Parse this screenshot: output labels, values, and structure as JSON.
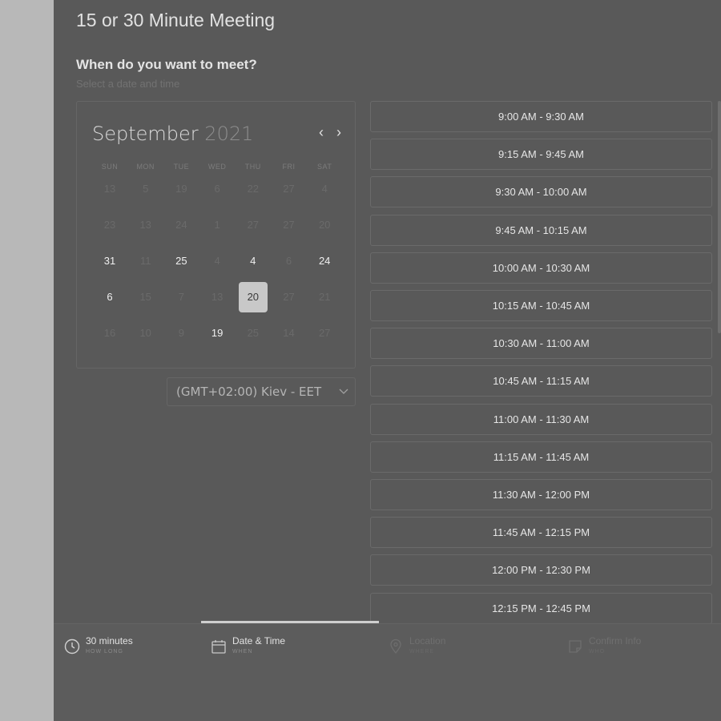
{
  "header": {
    "title": "15 or 30 Minute Meeting",
    "when_heading": "When do you want to meet?",
    "when_sub": "Select a date and time"
  },
  "calendar": {
    "month": "September",
    "year": "2021",
    "weekdays": [
      "SUN",
      "MON",
      "TUE",
      "WED",
      "THU",
      "FRI",
      "SAT"
    ],
    "weeks": [
      [
        {
          "d": "13",
          "a": false
        },
        {
          "d": "5",
          "a": false
        },
        {
          "d": "19",
          "a": false
        },
        {
          "d": "6",
          "a": false
        },
        {
          "d": "22",
          "a": false
        },
        {
          "d": "27",
          "a": false
        },
        {
          "d": "4",
          "a": false
        }
      ],
      [
        {
          "d": "23",
          "a": false
        },
        {
          "d": "13",
          "a": false
        },
        {
          "d": "24",
          "a": false
        },
        {
          "d": "1",
          "a": false
        },
        {
          "d": "27",
          "a": false
        },
        {
          "d": "27",
          "a": false
        },
        {
          "d": "20",
          "a": false
        }
      ],
      [
        {
          "d": "31",
          "a": true
        },
        {
          "d": "11",
          "a": false
        },
        {
          "d": "25",
          "a": true
        },
        {
          "d": "4",
          "a": false
        },
        {
          "d": "4",
          "a": true
        },
        {
          "d": "6",
          "a": false
        },
        {
          "d": "24",
          "a": true
        }
      ],
      [
        {
          "d": "6",
          "a": true
        },
        {
          "d": "15",
          "a": false
        },
        {
          "d": "7",
          "a": false
        },
        {
          "d": "13",
          "a": false
        },
        {
          "d": "20",
          "a": true,
          "selected": true
        },
        {
          "d": "27",
          "a": false
        },
        {
          "d": "21",
          "a": false
        }
      ],
      [
        {
          "d": "16",
          "a": false
        },
        {
          "d": "10",
          "a": false
        },
        {
          "d": "9",
          "a": false
        },
        {
          "d": "19",
          "a": true
        },
        {
          "d": "25",
          "a": false
        },
        {
          "d": "14",
          "a": false
        },
        {
          "d": "27",
          "a": false
        }
      ]
    ],
    "prev_icon": "chevron-left-icon",
    "next_icon": "chevron-right-icon"
  },
  "timezone": {
    "value": "(GMT+02:00) Kiev - EET",
    "icon": "chevron-down-icon"
  },
  "slots": [
    "9:00 AM - 9:30 AM",
    "9:15 AM - 9:45 AM",
    "9:30 AM - 10:00 AM",
    "9:45 AM - 10:15 AM",
    "10:00 AM - 10:30 AM",
    "10:15 AM - 10:45 AM",
    "10:30 AM - 11:00 AM",
    "10:45 AM - 11:15 AM",
    "11:00 AM - 11:30 AM",
    "11:15 AM - 11:45 AM",
    "11:30 AM - 12:00 PM",
    "11:45 AM - 12:15 PM",
    "12:00 PM - 12:30 PM",
    "12:15 PM - 12:45 PM"
  ],
  "steps": [
    {
      "label": "30 minutes",
      "sub": "HOW LONG",
      "icon": "clock-icon",
      "active": true
    },
    {
      "label": "Date & Time",
      "sub": "WHEN",
      "icon": "calendar-icon",
      "active": true
    },
    {
      "label": "Location",
      "sub": "WHERE",
      "icon": "location-pin-icon",
      "active": false
    },
    {
      "label": "Confirm Info",
      "sub": "WHO",
      "icon": "note-icon",
      "active": false
    }
  ],
  "colors": {
    "overlay_panel": "#595959",
    "left_background": "#b8b8b8",
    "selected_day": "#c8c8c8"
  }
}
